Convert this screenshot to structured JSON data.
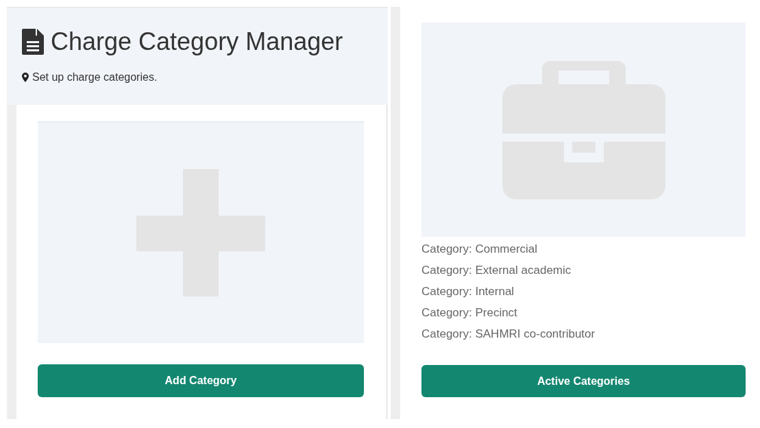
{
  "header": {
    "title": "Charge Category Manager",
    "subtitle": "Set up charge categories."
  },
  "add_panel": {
    "button": "Add Category"
  },
  "active_panel": {
    "categories": [
      {
        "label": "Category:",
        "name": "Commercial"
      },
      {
        "label": "Category:",
        "name": "External academic"
      },
      {
        "label": "Category:",
        "name": "Internal"
      },
      {
        "label": "Category:",
        "name": "Precinct"
      },
      {
        "label": "Category:",
        "name": "SAHMRI co-contributor"
      }
    ],
    "button": "Active Categories"
  }
}
